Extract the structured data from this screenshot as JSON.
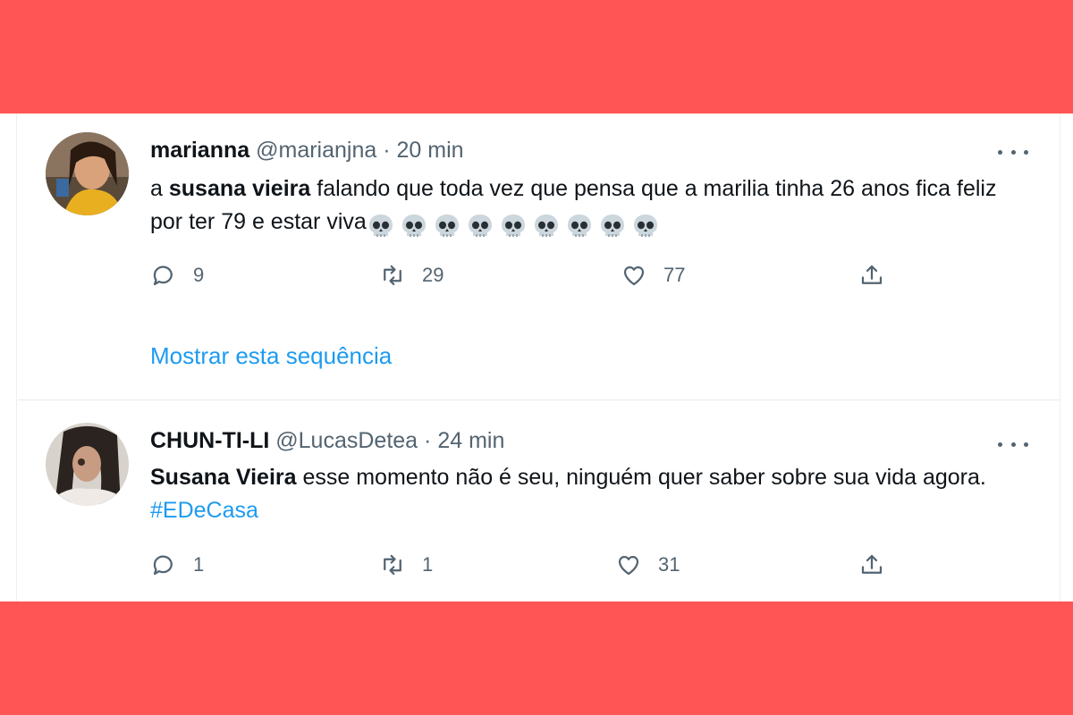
{
  "tweets": [
    {
      "display_name": "marianna",
      "handle": "@marianjna",
      "separator": "·",
      "time": "20 min",
      "text_before": "a ",
      "text_bold": "susana vieira",
      "text_after": " falando que toda vez que pensa que a marilia tinha 26 anos fica feliz por ter 79 e estar viva",
      "emoji_count": 9,
      "emoji_icon": "skull-emoji",
      "replies": "9",
      "retweets": "29",
      "likes": "77",
      "show_thread": "Mostrar esta sequência"
    },
    {
      "display_name": "CHUN-TI-LI",
      "handle": "@LucasDetea",
      "separator": "·",
      "time": "24 min",
      "text_bold": "Susana Vieira",
      "text_after": " esse momento não é seu, ninguém quer saber sobre sua vida agora. ",
      "hashtag": "#EDeCasa",
      "replies": "1",
      "retweets": "1",
      "likes": "31"
    }
  ],
  "colors": {
    "background_band": "#ff5555",
    "card": "#ffffff",
    "link": "#1d9bf0",
    "secondary_text": "#536471",
    "primary_text": "#0f1419"
  }
}
